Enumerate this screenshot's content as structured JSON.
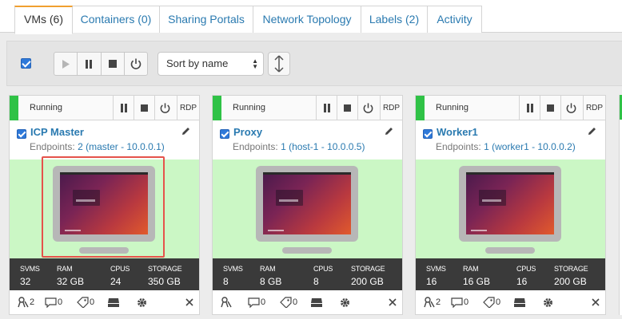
{
  "tabs": [
    {
      "label": "VMs (6)",
      "active": true
    },
    {
      "label": "Containers (0)"
    },
    {
      "label": "Sharing Portals"
    },
    {
      "label": "Network Topology"
    },
    {
      "label": "Labels (2)"
    },
    {
      "label": "Activity"
    }
  ],
  "toolbar": {
    "sort_value": "Sort by name",
    "icons": [
      "play-icon",
      "pause-icon",
      "stop-icon",
      "power-icon"
    ],
    "sort_toggle_icon": "sort-updown-icon"
  },
  "colors": {
    "link": "#2a7ab0",
    "running": "#2fc246",
    "preview_bg": "#cbf7c5",
    "stats_bg": "#3a3a3a",
    "highlight": "#e5534b",
    "checkbox": "#2f79d9"
  },
  "stat_keys": {
    "svms": "SVMS",
    "ram": "RAM",
    "cpus": "CPUS",
    "storage": "STORAGE"
  },
  "endpoints_label": "Endpoints:",
  "rdp_label": "RDP",
  "vms": [
    {
      "status": "Running",
      "name": "ICP Master",
      "endpoints": "2 (master - 10.0.0.1)",
      "svms": "32",
      "ram": "32 GB",
      "cpus": "24",
      "storage": "350 GB",
      "footer": {
        "users": "2",
        "comments": "0",
        "tags": "0"
      },
      "highlighted": true
    },
    {
      "status": "Running",
      "name": "Proxy",
      "endpoints": "1 (host-1 - 10.0.0.5)",
      "svms": "8",
      "ram": "8 GB",
      "cpus": "8",
      "storage": "200 GB",
      "footer": {
        "users": "",
        "comments": "0",
        "tags": "0"
      }
    },
    {
      "status": "Running",
      "name": "Worker1",
      "endpoints": "1 (worker1 - 10.0.0.2)",
      "svms": "16",
      "ram": "16 GB",
      "cpus": "16",
      "storage": "200 GB",
      "footer": {
        "users": "2",
        "comments": "0",
        "tags": "0"
      }
    }
  ]
}
